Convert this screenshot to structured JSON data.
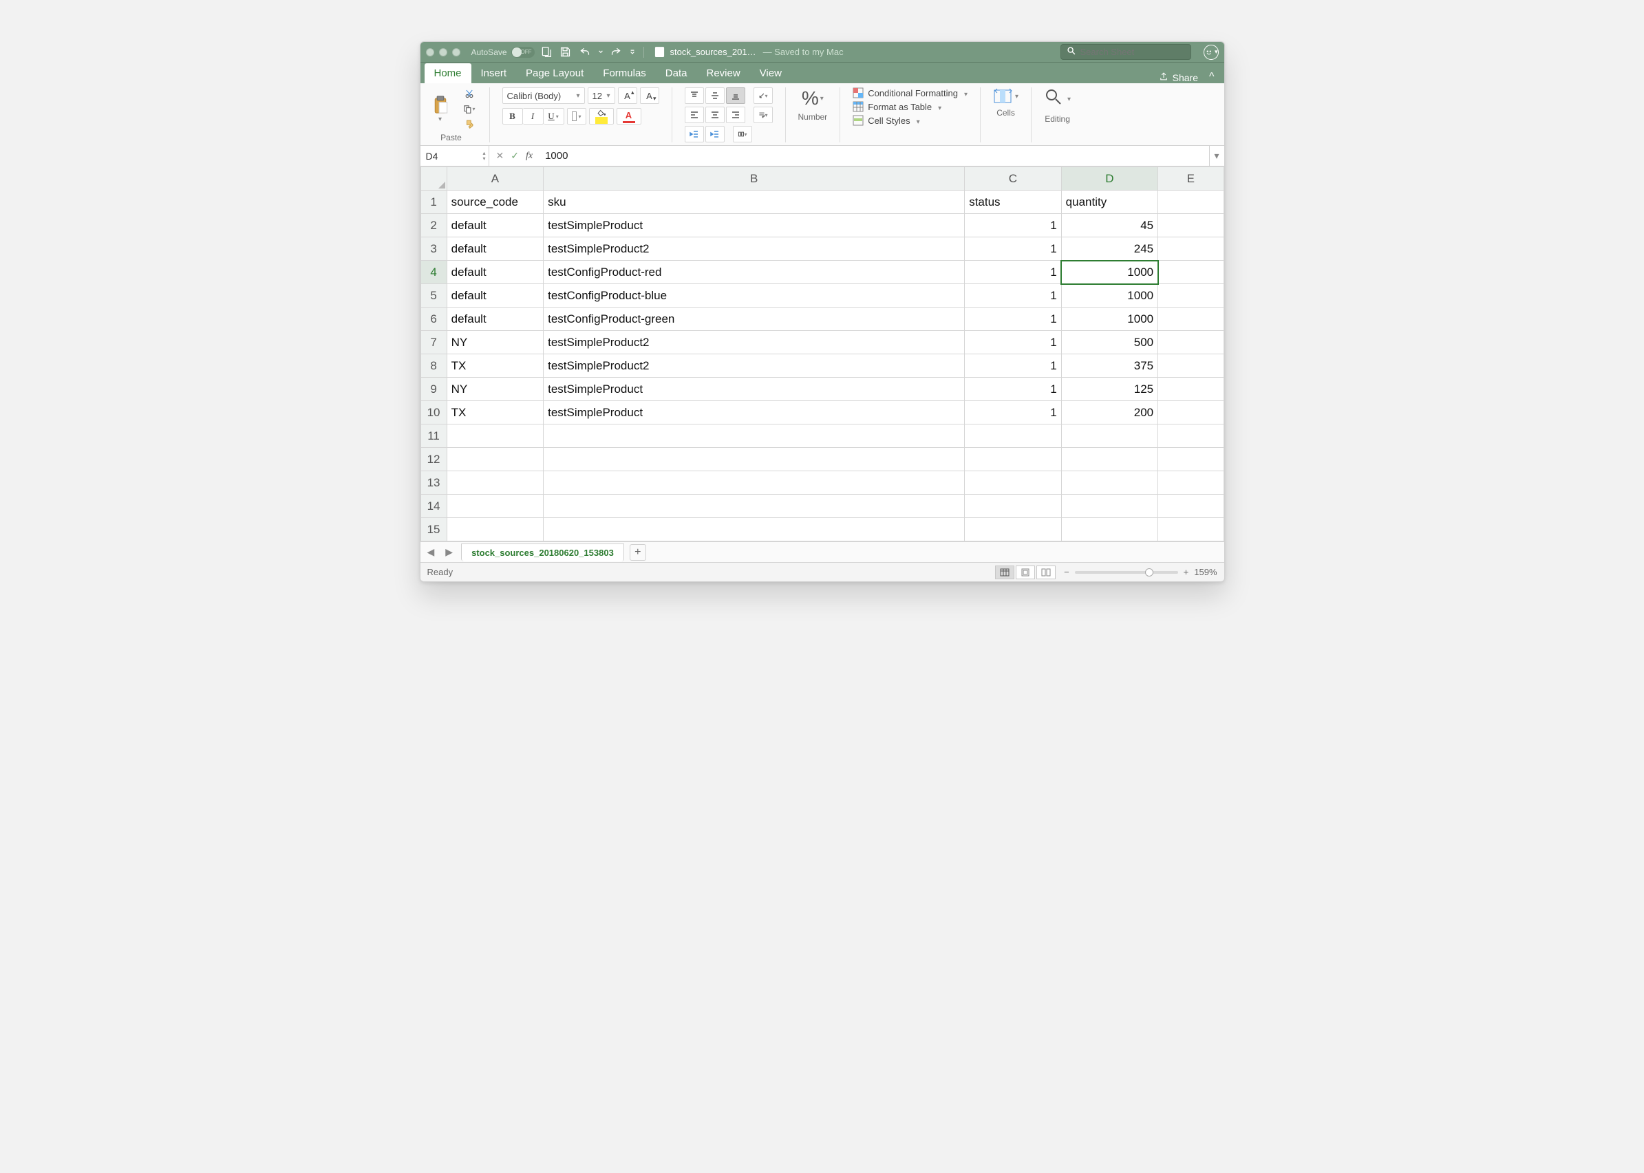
{
  "titlebar": {
    "autosave_label": "AutoSave",
    "autosave_state": "OFF",
    "file_name": "stock_sources_201…",
    "saved_text": "— Saved to my Mac",
    "search_placeholder": "Search Sheet"
  },
  "tabs": {
    "items": [
      "Home",
      "Insert",
      "Page Layout",
      "Formulas",
      "Data",
      "Review",
      "View"
    ],
    "share_label": "Share"
  },
  "ribbon": {
    "paste": "Paste",
    "font_name": "Calibri (Body)",
    "font_size": "12",
    "number": "Number",
    "cond_fmt": "Conditional Formatting",
    "fmt_table": "Format as Table",
    "cell_styles": "Cell Styles",
    "cells": "Cells",
    "editing": "Editing"
  },
  "formula": {
    "cell_ref": "D4",
    "value": "1000"
  },
  "columns": [
    "A",
    "B",
    "C",
    "D",
    "E"
  ],
  "col_widths": [
    "140px",
    "610px",
    "140px",
    "140px",
    "95px"
  ],
  "selected_col_index": 3,
  "selected_row_index": 3,
  "rows": [
    {
      "n": "1",
      "cells": [
        "source_code",
        "sku",
        "status",
        "quantity",
        ""
      ],
      "align": [
        "l",
        "l",
        "l",
        "l",
        "l"
      ]
    },
    {
      "n": "2",
      "cells": [
        "default",
        "testSimpleProduct",
        "1",
        "45",
        ""
      ],
      "align": [
        "l",
        "l",
        "r",
        "r",
        "l"
      ]
    },
    {
      "n": "3",
      "cells": [
        "default",
        "testSimpleProduct2",
        "1",
        "245",
        ""
      ],
      "align": [
        "l",
        "l",
        "r",
        "r",
        "l"
      ]
    },
    {
      "n": "4",
      "cells": [
        "default",
        "testConfigProduct-red",
        "1",
        "1000",
        ""
      ],
      "align": [
        "l",
        "l",
        "r",
        "r",
        "l"
      ],
      "active_col": 3
    },
    {
      "n": "5",
      "cells": [
        "default",
        "testConfigProduct-blue",
        "1",
        "1000",
        ""
      ],
      "align": [
        "l",
        "l",
        "r",
        "r",
        "l"
      ]
    },
    {
      "n": "6",
      "cells": [
        "default",
        "testConfigProduct-green",
        "1",
        "1000",
        ""
      ],
      "align": [
        "l",
        "l",
        "r",
        "r",
        "l"
      ]
    },
    {
      "n": "7",
      "cells": [
        "NY",
        "testSimpleProduct2",
        "1",
        "500",
        ""
      ],
      "align": [
        "l",
        "l",
        "r",
        "r",
        "l"
      ]
    },
    {
      "n": "8",
      "cells": [
        "TX",
        "testSimpleProduct2",
        "1",
        "375",
        ""
      ],
      "align": [
        "l",
        "l",
        "r",
        "r",
        "l"
      ]
    },
    {
      "n": "9",
      "cells": [
        "NY",
        "testSimpleProduct",
        "1",
        "125",
        ""
      ],
      "align": [
        "l",
        "l",
        "r",
        "r",
        "l"
      ]
    },
    {
      "n": "10",
      "cells": [
        "TX",
        "testSimpleProduct",
        "1",
        "200",
        ""
      ],
      "align": [
        "l",
        "l",
        "r",
        "r",
        "l"
      ]
    },
    {
      "n": "11",
      "cells": [
        "",
        "",
        "",
        "",
        ""
      ],
      "align": [
        "l",
        "l",
        "l",
        "l",
        "l"
      ]
    },
    {
      "n": "12",
      "cells": [
        "",
        "",
        "",
        "",
        ""
      ],
      "align": [
        "l",
        "l",
        "l",
        "l",
        "l"
      ]
    },
    {
      "n": "13",
      "cells": [
        "",
        "",
        "",
        "",
        ""
      ],
      "align": [
        "l",
        "l",
        "l",
        "l",
        "l"
      ]
    },
    {
      "n": "14",
      "cells": [
        "",
        "",
        "",
        "",
        ""
      ],
      "align": [
        "l",
        "l",
        "l",
        "l",
        "l"
      ]
    },
    {
      "n": "15",
      "cells": [
        "",
        "",
        "",
        "",
        ""
      ],
      "align": [
        "l",
        "l",
        "l",
        "l",
        "l"
      ]
    }
  ],
  "sheet_tab": "stock_sources_20180620_153803",
  "status": {
    "ready": "Ready",
    "zoom": "159%"
  }
}
